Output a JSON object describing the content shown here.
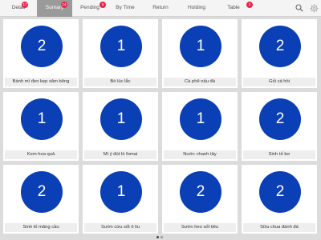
{
  "tabs": [
    {
      "label": "Detail",
      "badge": "17"
    },
    {
      "label": "Sumary",
      "badge": "14"
    },
    {
      "label": "Pending",
      "badge": "6"
    },
    {
      "label": "By Time",
      "badge": ""
    },
    {
      "label": "Return",
      "badge": ""
    },
    {
      "label": "Holding",
      "badge": ""
    },
    {
      "label": "Table",
      "badge": "2"
    }
  ],
  "items": [
    {
      "count": "2",
      "name": "Bánh mì đen kẹp xăm bông"
    },
    {
      "count": "1",
      "name": "Bò lúc lắc"
    },
    {
      "count": "1",
      "name": "Cà phê nấu đá"
    },
    {
      "count": "2",
      "name": "Gỏi cá hồi"
    },
    {
      "count": "1",
      "name": "Kem hoa quả"
    },
    {
      "count": "1",
      "name": "Mì ý đút lò fomai"
    },
    {
      "count": "1",
      "name": "Nước chanh tây"
    },
    {
      "count": "2",
      "name": "Sinh tố bơ"
    },
    {
      "count": "2",
      "name": "Sinh tố mãng cầu"
    },
    {
      "count": "1",
      "name": "Sườn cừu sốt ô liu"
    },
    {
      "count": "2",
      "name": "Sườn heo sốt tiêu"
    },
    {
      "count": "2",
      "name": "Sữa chua đánh đá"
    }
  ],
  "colors": {
    "accent": "#0a3fb5",
    "badge": "#e8264c",
    "active_tab": "#9a9a9a"
  },
  "icons": {
    "search": "search-icon",
    "settings": "gear-icon"
  }
}
